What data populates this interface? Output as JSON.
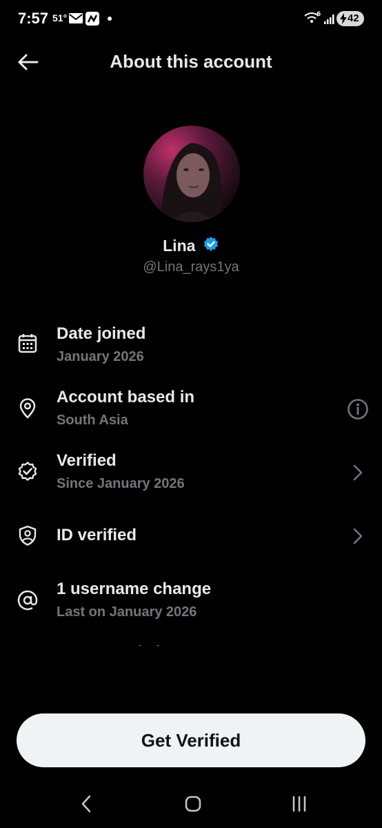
{
  "status_bar": {
    "time": "7:57",
    "temperature": "51°",
    "battery": "42",
    "icons": [
      "mail-icon",
      "app-notification-icon",
      "dot-icon",
      "wifi-icon",
      "signal-icon",
      "battery-charging-icon"
    ]
  },
  "header": {
    "title": "About this account",
    "back_icon": "arrow-left-icon"
  },
  "profile": {
    "name": "Lina",
    "handle": "@Lina_rays1ya",
    "verified_color": "#1d9bf0"
  },
  "rows": [
    {
      "icon": "calendar-icon",
      "title": "Date joined",
      "subtitle": "January 2026"
    },
    {
      "icon": "location-pin-icon",
      "title": "Account based in",
      "subtitle": "South Asia",
      "trailing": "info-icon"
    },
    {
      "icon": "verified-check-icon",
      "title": "Verified",
      "subtitle": "Since January 2026",
      "trailing": "chevron-right-icon"
    },
    {
      "icon": "id-shield-icon",
      "title": "ID verified",
      "trailing": "chevron-right-icon"
    },
    {
      "icon": "at-sign-icon",
      "title": "1 username change",
      "subtitle": "Last on January 2026"
    },
    {
      "title": "Connected via"
    }
  ],
  "cta": {
    "label": "Get Verified"
  },
  "nav": {
    "icons": [
      "back-nav-icon",
      "home-nav-icon",
      "recents-nav-icon"
    ]
  },
  "colors": {
    "background": "#000000",
    "text_primary": "#e7e9ea",
    "text_secondary": "#71767b",
    "button_bg": "#eff3f4"
  }
}
